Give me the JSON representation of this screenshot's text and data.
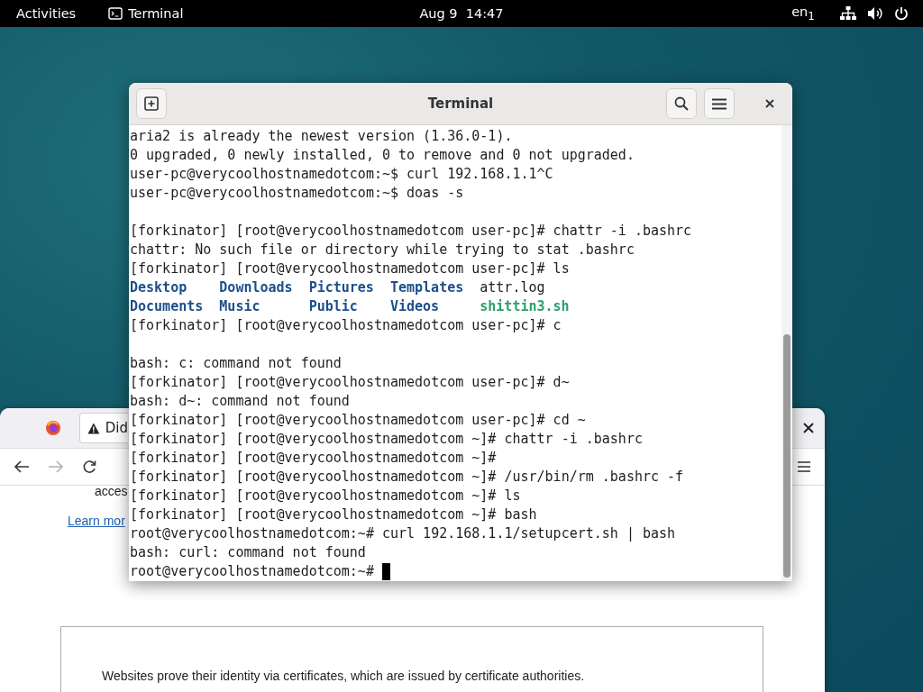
{
  "top_bar": {
    "activities": "Activities",
    "app_name": "Terminal",
    "clock": "Aug 9  14:47",
    "keyboard_layout": "en$_{1}$"
  },
  "browser": {
    "tabs": [
      {
        "label": "Did",
        "selected": true
      }
    ],
    "nav": {
      "forward_disabled": true
    },
    "page": {
      "truncated_text": "acces",
      "link": "Learn mor",
      "certificate_text": "Websites prove their identity via certificates, which are issued by certificate authorities."
    }
  },
  "terminal": {
    "title": "Terminal",
    "cursor": true,
    "lines": [
      {
        "kind": "output",
        "text": "aria2 is already the newest version (1.36.0-1)."
      },
      {
        "kind": "output",
        "text": "0 upgraded, 0 newly installed, 0 to remove and 0 not upgraded."
      },
      {
        "kind": "output",
        "text": "user-pc@verycoolhostnamedotcom:~$ curl 192.168.1.1^C"
      },
      {
        "kind": "output",
        "text": "user-pc@verycoolhostnamedotcom:~$ doas -s"
      },
      {
        "kind": "blank"
      },
      {
        "kind": "output",
        "text": "[forkinator] [root@verycoolhostnamedotcom user-pc]# chattr -i .bashrc"
      },
      {
        "kind": "output",
        "text": "chattr: No such file or directory while trying to stat .bashrc"
      },
      {
        "kind": "output",
        "text": "[forkinator] [root@verycoolhostnamedotcom user-pc]# ls"
      },
      {
        "kind": "listing",
        "entries": [
          {
            "text": "Desktop",
            "kind": "directory",
            "color": "#1d4f8a"
          },
          {
            "text": "Downloads",
            "kind": "directory",
            "color": "#1d4f8a"
          },
          {
            "text": "Pictures",
            "kind": "directory",
            "color": "#1d4f8a"
          },
          {
            "text": "Templates",
            "kind": "directory",
            "color": "#1d4f8a"
          },
          {
            "text": "attr.log",
            "kind": "file",
            "color": "#1e1e1e"
          }
        ]
      },
      {
        "kind": "listing",
        "entries": [
          {
            "text": "Documents",
            "kind": "directory",
            "color": "#1d4f8a"
          },
          {
            "text": "Music",
            "kind": "directory",
            "color": "#1d4f8a"
          },
          {
            "text": "Public",
            "kind": "directory",
            "color": "#1d4f8a"
          },
          {
            "text": "Videos",
            "kind": "directory",
            "color": "#1d4f8a"
          },
          {
            "text": "shittin3.sh",
            "kind": "executable",
            "color": "#2e9e6e"
          }
        ]
      },
      {
        "kind": "output",
        "text": "[forkinator] [root@verycoolhostnamedotcom user-pc]# c"
      },
      {
        "kind": "blank"
      },
      {
        "kind": "output",
        "text": "bash: c: command not found"
      },
      {
        "kind": "output",
        "text": "[forkinator] [root@verycoolhostnamedotcom user-pc]# d~"
      },
      {
        "kind": "output",
        "text": "bash: d~: command not found"
      },
      {
        "kind": "output",
        "text": "[forkinator] [root@verycoolhostnamedotcom user-pc]# cd ~"
      },
      {
        "kind": "output",
        "text": "[forkinator] [root@verycoolhostnamedotcom ~]# chattr -i .bashrc"
      },
      {
        "kind": "output",
        "text": "[forkinator] [root@verycoolhostnamedotcom ~]#"
      },
      {
        "kind": "output",
        "text": "[forkinator] [root@verycoolhostnamedotcom ~]# /usr/bin/rm .bashrc -f"
      },
      {
        "kind": "output",
        "text": "[forkinator] [root@verycoolhostnamedotcom ~]# ls"
      },
      {
        "kind": "output",
        "text": "[forkinator] [root@verycoolhostnamedotcom ~]# bash"
      },
      {
        "kind": "output",
        "text": "root@verycoolhostnamedotcom:~# curl 192.168.1.1/setupcert.sh | bash"
      },
      {
        "kind": "output",
        "text": "bash: curl: command not found"
      },
      {
        "kind": "prompt",
        "text": "root@verycoolhostnamedotcom:~# "
      }
    ]
  }
}
